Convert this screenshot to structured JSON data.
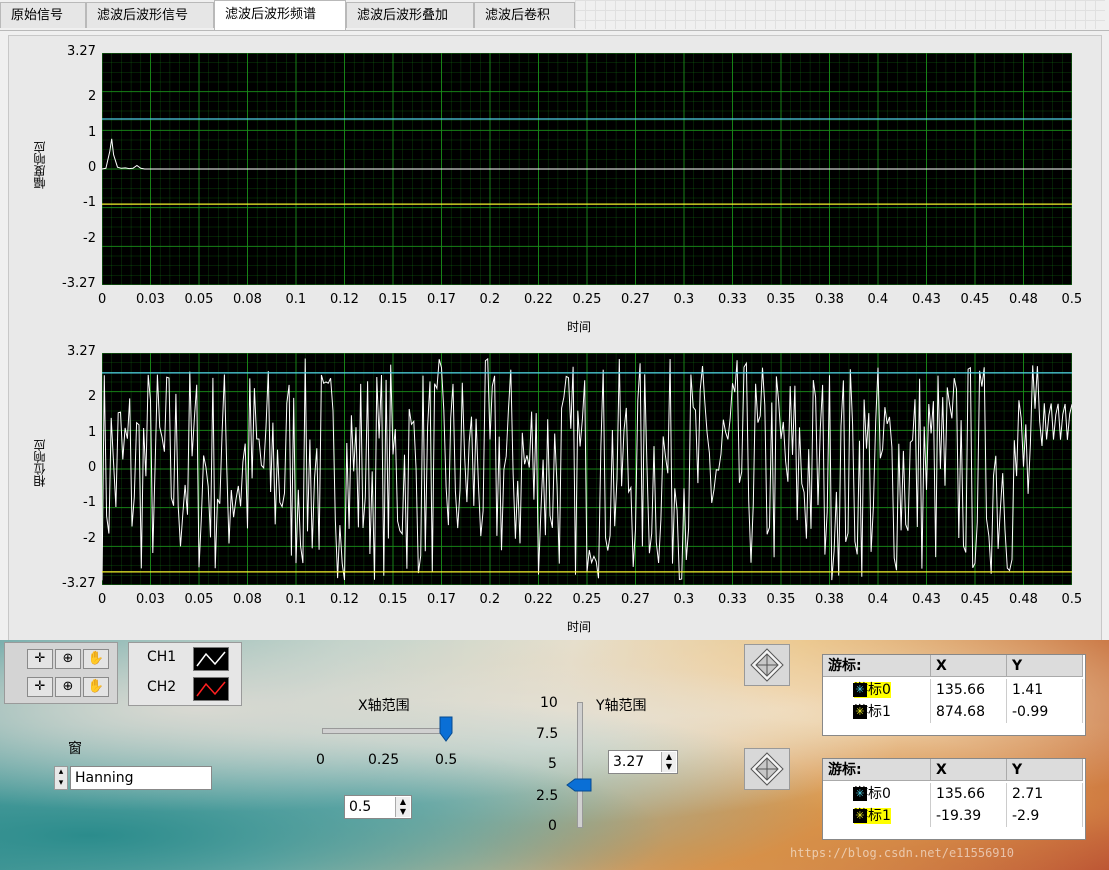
{
  "tabs": [
    "原始信号",
    "滤波后波形信号",
    "滤波后波形频谱",
    "滤波后波形叠加",
    "滤波后卷积"
  ],
  "active_tab": 2,
  "colors": {
    "plot_bg": "#000000",
    "grid": "#1a8f1a",
    "trace": "#ffffff",
    "cursor0": "#4fd0e8",
    "cursor1": "#f2f22a"
  },
  "graph1": {
    "ylabel": "幅度响应",
    "xlabel": "时间"
  },
  "graph2": {
    "ylabel": "相位响应",
    "xlabel": "时间"
  },
  "chart_data": [
    {
      "type": "line",
      "ylabel": "幅度响应",
      "xlabel": "时间",
      "xlim": [
        0,
        0.5
      ],
      "ylim": [
        -3.27,
        3.27
      ],
      "x_ticks": [
        "0",
        "0.03",
        "0.05",
        "0.08",
        "0.1",
        "0.12",
        "0.15",
        "0.17",
        "0.2",
        "0.22",
        "0.25",
        "0.27",
        "0.3",
        "0.33",
        "0.35",
        "0.38",
        "0.4",
        "0.43",
        "0.45",
        "0.48",
        "0.5"
      ],
      "y_ticks": [
        "3.27",
        "2",
        "1",
        "0",
        "-1",
        "-2",
        "-3.27"
      ],
      "cursors": [
        {
          "name": "游标0",
          "y": 1.41
        },
        {
          "name": "游标1",
          "y": -0.99
        }
      ],
      "series": [
        {
          "x": [
            0,
            0.002,
            0.004,
            0.005,
            0.006,
            0.008,
            0.01,
            0.012,
            0.014,
            0.016,
            0.018,
            0.02,
            0.022,
            0.5
          ],
          "y": [
            0,
            0.02,
            0.5,
            0.85,
            0.4,
            0.05,
            0.02,
            0.03,
            0.01,
            0.02,
            0.1,
            0.02,
            0,
            0
          ]
        }
      ]
    },
    {
      "type": "line",
      "ylabel": "相位响应",
      "xlabel": "时间",
      "xlim": [
        0,
        0.5
      ],
      "ylim": [
        -3.27,
        3.27
      ],
      "x_ticks": [
        "0",
        "0.03",
        "0.05",
        "0.08",
        "0.1",
        "0.12",
        "0.15",
        "0.17",
        "0.2",
        "0.22",
        "0.25",
        "0.27",
        "0.3",
        "0.33",
        "0.35",
        "0.38",
        "0.4",
        "0.43",
        "0.45",
        "0.48",
        "0.5"
      ],
      "y_ticks": [
        "3.27",
        "2",
        "1",
        "0",
        "-1",
        "-2",
        "-3.27"
      ],
      "cursors": [
        {
          "name": "游标0",
          "y": 2.71
        },
        {
          "name": "游标1",
          "y": -2.9
        }
      ],
      "series": [
        {
          "x_range": [
            0,
            0.5
          ],
          "y_range": [
            -3.14,
            3.14
          ]
        }
      ]
    }
  ],
  "controls": {
    "legend": [
      {
        "name": "CH1",
        "color": "#ffffff"
      },
      {
        "name": "CH2",
        "color": "#ff2020"
      }
    ],
    "window_label": "窗",
    "window_value": "Hanning",
    "x_range_label": "X轴范围",
    "x_slider_ticks": [
      "0",
      "0.25",
      "0.5"
    ],
    "x_slider_value": 0.5,
    "x_range_value": "0.5",
    "y_range_label": "Y轴范围",
    "y_slider_ticks": [
      "10",
      "7.5",
      "5",
      "2.5",
      "0"
    ],
    "y_slider_value": 3.27,
    "y_range_value": "3.27"
  },
  "cursor_tables": [
    {
      "headers": [
        "游标:",
        "X",
        "Y"
      ],
      "rows": [
        [
          "游标0",
          "135.66",
          "1.41"
        ],
        [
          "游标1",
          "874.68",
          "-0.99"
        ]
      ],
      "highlight": 0
    },
    {
      "headers": [
        "游标:",
        "X",
        "Y"
      ],
      "rows": [
        [
          "游标0",
          "135.66",
          "2.71"
        ],
        [
          "游标1",
          "-19.39",
          "-2.9"
        ]
      ],
      "highlight": 1
    }
  ],
  "watermark": "https://blog.csdn.net/e11556910"
}
